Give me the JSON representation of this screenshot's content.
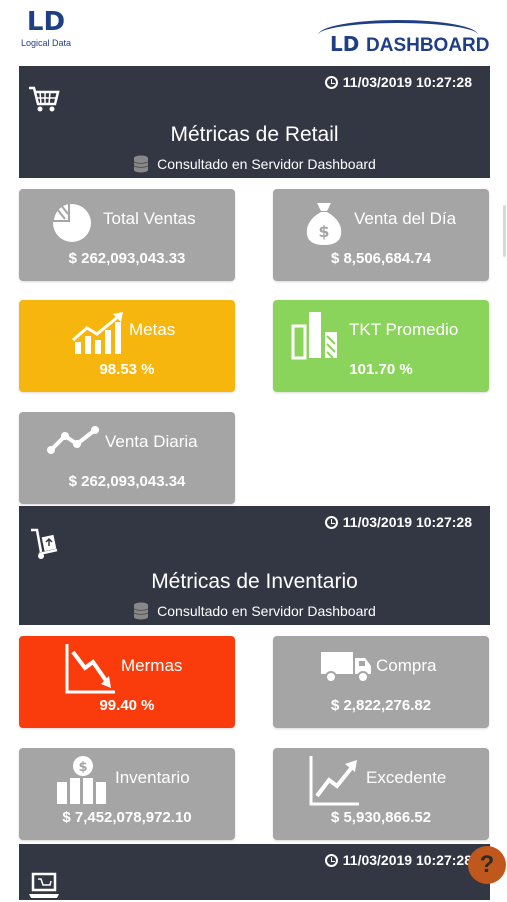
{
  "header": {
    "logo_left_text": "LD",
    "logo_left_sub": "Logical Data",
    "logo_right_ld": "LD",
    "logo_right_text": "DASHBOARD"
  },
  "sections": {
    "retail": {
      "timestamp": "11/03/2019 10:27:28",
      "title": "Métricas de Retail",
      "subtitle": "Consultado en Servidor Dashboard",
      "icon": "shopping-cart-icon"
    },
    "inventory": {
      "timestamp": "11/03/2019 10:27:28",
      "title": "Métricas de Inventario",
      "subtitle": "Consultado en Servidor Dashboard",
      "icon": "hand-truck-icon"
    },
    "third": {
      "timestamp": "11/03/2019 10:27:28",
      "icon": "laptop-icon"
    }
  },
  "cards": {
    "total_ventas": {
      "label": "Total Ventas",
      "value": "$ 262,093,043.33",
      "icon": "pie-chart-icon"
    },
    "venta_dia": {
      "label": "Venta del Día",
      "value": "$ 8,506,684.74",
      "icon": "money-bag-icon"
    },
    "metas": {
      "label": "Metas",
      "value": "98.53 %",
      "icon": "growth-chart-icon"
    },
    "tkt_promedio": {
      "label": "TKT Promedio",
      "value": "101.70 %",
      "icon": "bar-chart-icon"
    },
    "venta_diaria": {
      "label": "Venta Diaria",
      "value": "$ 262,093,043.34",
      "icon": "line-trend-icon"
    },
    "mermas": {
      "label": "Mermas",
      "value": "99.40 %",
      "icon": "downtrend-icon"
    },
    "compra": {
      "label": "Compra",
      "value": "$ 2,822,276.82",
      "icon": "truck-icon"
    },
    "inventario": {
      "label": "Inventario",
      "value": "$ 7,452,078,972.10",
      "icon": "inventory-icon"
    },
    "excedente": {
      "label": "Excedente",
      "value": "$ 5,930,866.52",
      "icon": "uptrend-icon"
    }
  },
  "help_button": {
    "label": "?",
    "icon": "help-icon"
  },
  "colors": {
    "section_bg": "#333744",
    "card_gray": "#a5a5a5",
    "card_yellow": "#f6b60e",
    "card_green": "#8bd45b",
    "card_red": "#fa3c0c",
    "brand_blue": "#1f3f85",
    "help_orange": "#c0581d"
  }
}
